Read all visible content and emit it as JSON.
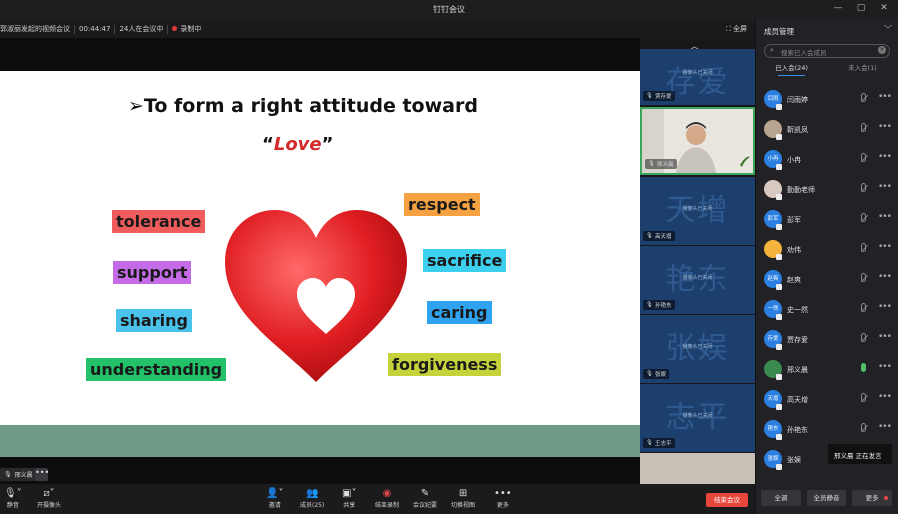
{
  "window": {
    "title": "钉钉会议",
    "controls": [
      "—",
      "▢",
      "✕"
    ]
  },
  "infobar": {
    "meeting_name": "郭淑丽发起的视频会议",
    "duration": "00:44:47",
    "participants_text": "24人在会议中",
    "recording_text": "录制中",
    "fullscreen_label": "全屏"
  },
  "slide": {
    "heading": "➢To form a right attitude toward",
    "love_quote_open": "“",
    "love_word": "Love",
    "love_quote_close": "”",
    "words": [
      {
        "text": "tolerance",
        "color": "#f05b5b"
      },
      {
        "text": "support",
        "color": "#c56be8"
      },
      {
        "text": "sharing",
        "color": "#49c3ec"
      },
      {
        "text": "understanding",
        "color": "#22c16a"
      },
      {
        "text": "respect",
        "color": "#f6a242"
      },
      {
        "text": "sacrifice",
        "color": "#3cd0ee"
      },
      {
        "text": "caring",
        "color": "#2ea3f0"
      },
      {
        "text": "forgiveness",
        "color": "#c6d23a"
      }
    ],
    "band_color": "#6f9a87"
  },
  "speaker_tag": {
    "name": "邢义晨",
    "more": "•••"
  },
  "thumbnails": {
    "camera_off_text": "摄像头已关闭",
    "items": [
      {
        "big": "存爱",
        "name": "贾存爱",
        "video": false
      },
      {
        "big": "",
        "name": "邢义晨",
        "video": true
      },
      {
        "big": "天增",
        "name": "高天增",
        "video": false
      },
      {
        "big": "艳东",
        "name": "孙艳东",
        "video": false
      },
      {
        "big": "张娱",
        "name": "张娱",
        "video": false
      },
      {
        "big": "志平",
        "name": "王志平",
        "video": false
      }
    ]
  },
  "panel": {
    "title": "成员管理",
    "search_placeholder": "搜索已入会成员",
    "tab_joined": "已入会(24)",
    "tab_not_joined": "未入会(1)",
    "members": [
      {
        "avatar": "闫雨",
        "name": "闫雨婷",
        "style": "blue",
        "mic": "muted"
      },
      {
        "avatar": "",
        "name": "靳凯凤",
        "style": "photo",
        "mic": "muted"
      },
      {
        "avatar": "小冉",
        "name": "小冉",
        "style": "blue",
        "mic": "muted"
      },
      {
        "avatar": "",
        "name": "勤勤老师",
        "style": "photo2",
        "mic": "muted"
      },
      {
        "avatar": "彭军",
        "name": "彭军",
        "style": "blue",
        "mic": "muted"
      },
      {
        "avatar": "",
        "name": "劝伟",
        "style": "photo3",
        "mic": "muted"
      },
      {
        "avatar": "赵爽",
        "name": "赵爽",
        "style": "blue",
        "mic": "muted"
      },
      {
        "avatar": "一然",
        "name": "史一然",
        "style": "blue",
        "mic": "muted"
      },
      {
        "avatar": "存爱",
        "name": "贾存爱",
        "style": "blue",
        "mic": "muted"
      },
      {
        "avatar": "",
        "name": "邢义晨",
        "style": "green",
        "mic": "on"
      },
      {
        "avatar": "天增",
        "name": "高天增",
        "style": "blue",
        "mic": "muted"
      },
      {
        "avatar": "艳东",
        "name": "孙艳东",
        "style": "blue",
        "mic": "muted"
      },
      {
        "avatar": "张娱",
        "name": "张娱",
        "style": "blue",
        "mic": "muted"
      }
    ],
    "speaking_text": "邢义晨  正在发言",
    "footer": {
      "mute_all_one": "全调",
      "mute_all": "全员静音",
      "more": "更多"
    }
  },
  "toolbar": {
    "mute": "静音",
    "camera": "开摄像头",
    "invite": "邀请",
    "members": "成员(25)",
    "share": "共享",
    "stop_record": "结束录制",
    "minutes": "会议纪要",
    "switch_view": "切换视图",
    "more": "更多",
    "end_meeting": "结束会议"
  }
}
